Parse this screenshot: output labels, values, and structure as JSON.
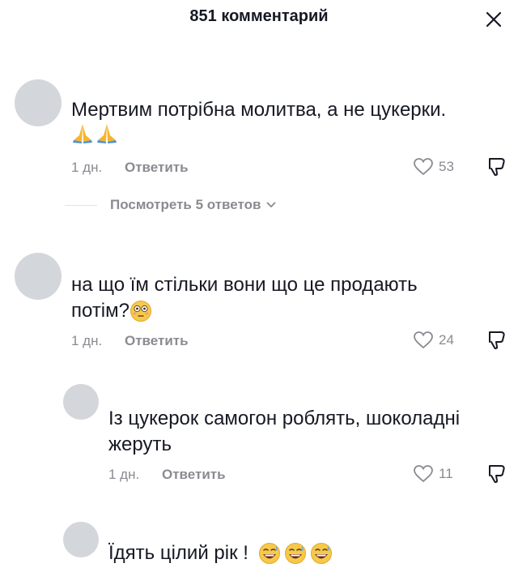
{
  "header": {
    "title": "851 комментарий"
  },
  "comments": [
    {
      "text": "Мертвим потрібна молитва, а не цукерки.",
      "emojis": [
        "folded-hands",
        "folded-hands"
      ],
      "time": "1 дн.",
      "reply_label": "Ответить",
      "likes": "53",
      "view_replies": "Посмотреть 5 ответов"
    },
    {
      "text_line1": "на що їм стільки вони що це продають",
      "text_line2": "потім?",
      "emojis": [
        "flushed-face"
      ],
      "time": "1 дн.",
      "reply_label": "Ответить",
      "likes": "24"
    }
  ],
  "replies": [
    {
      "text_line1": "Із цукерок самогон роблять, шоколадні",
      "text_line2": "жеруть",
      "time": "1 дн.",
      "reply_label": "Ответить",
      "likes": "11"
    },
    {
      "text": "Їдять цілий рік !",
      "emojis": [
        "grinning-sweat-face",
        "grinning-sweat-face",
        "grinning-sweat-face"
      ]
    }
  ]
}
